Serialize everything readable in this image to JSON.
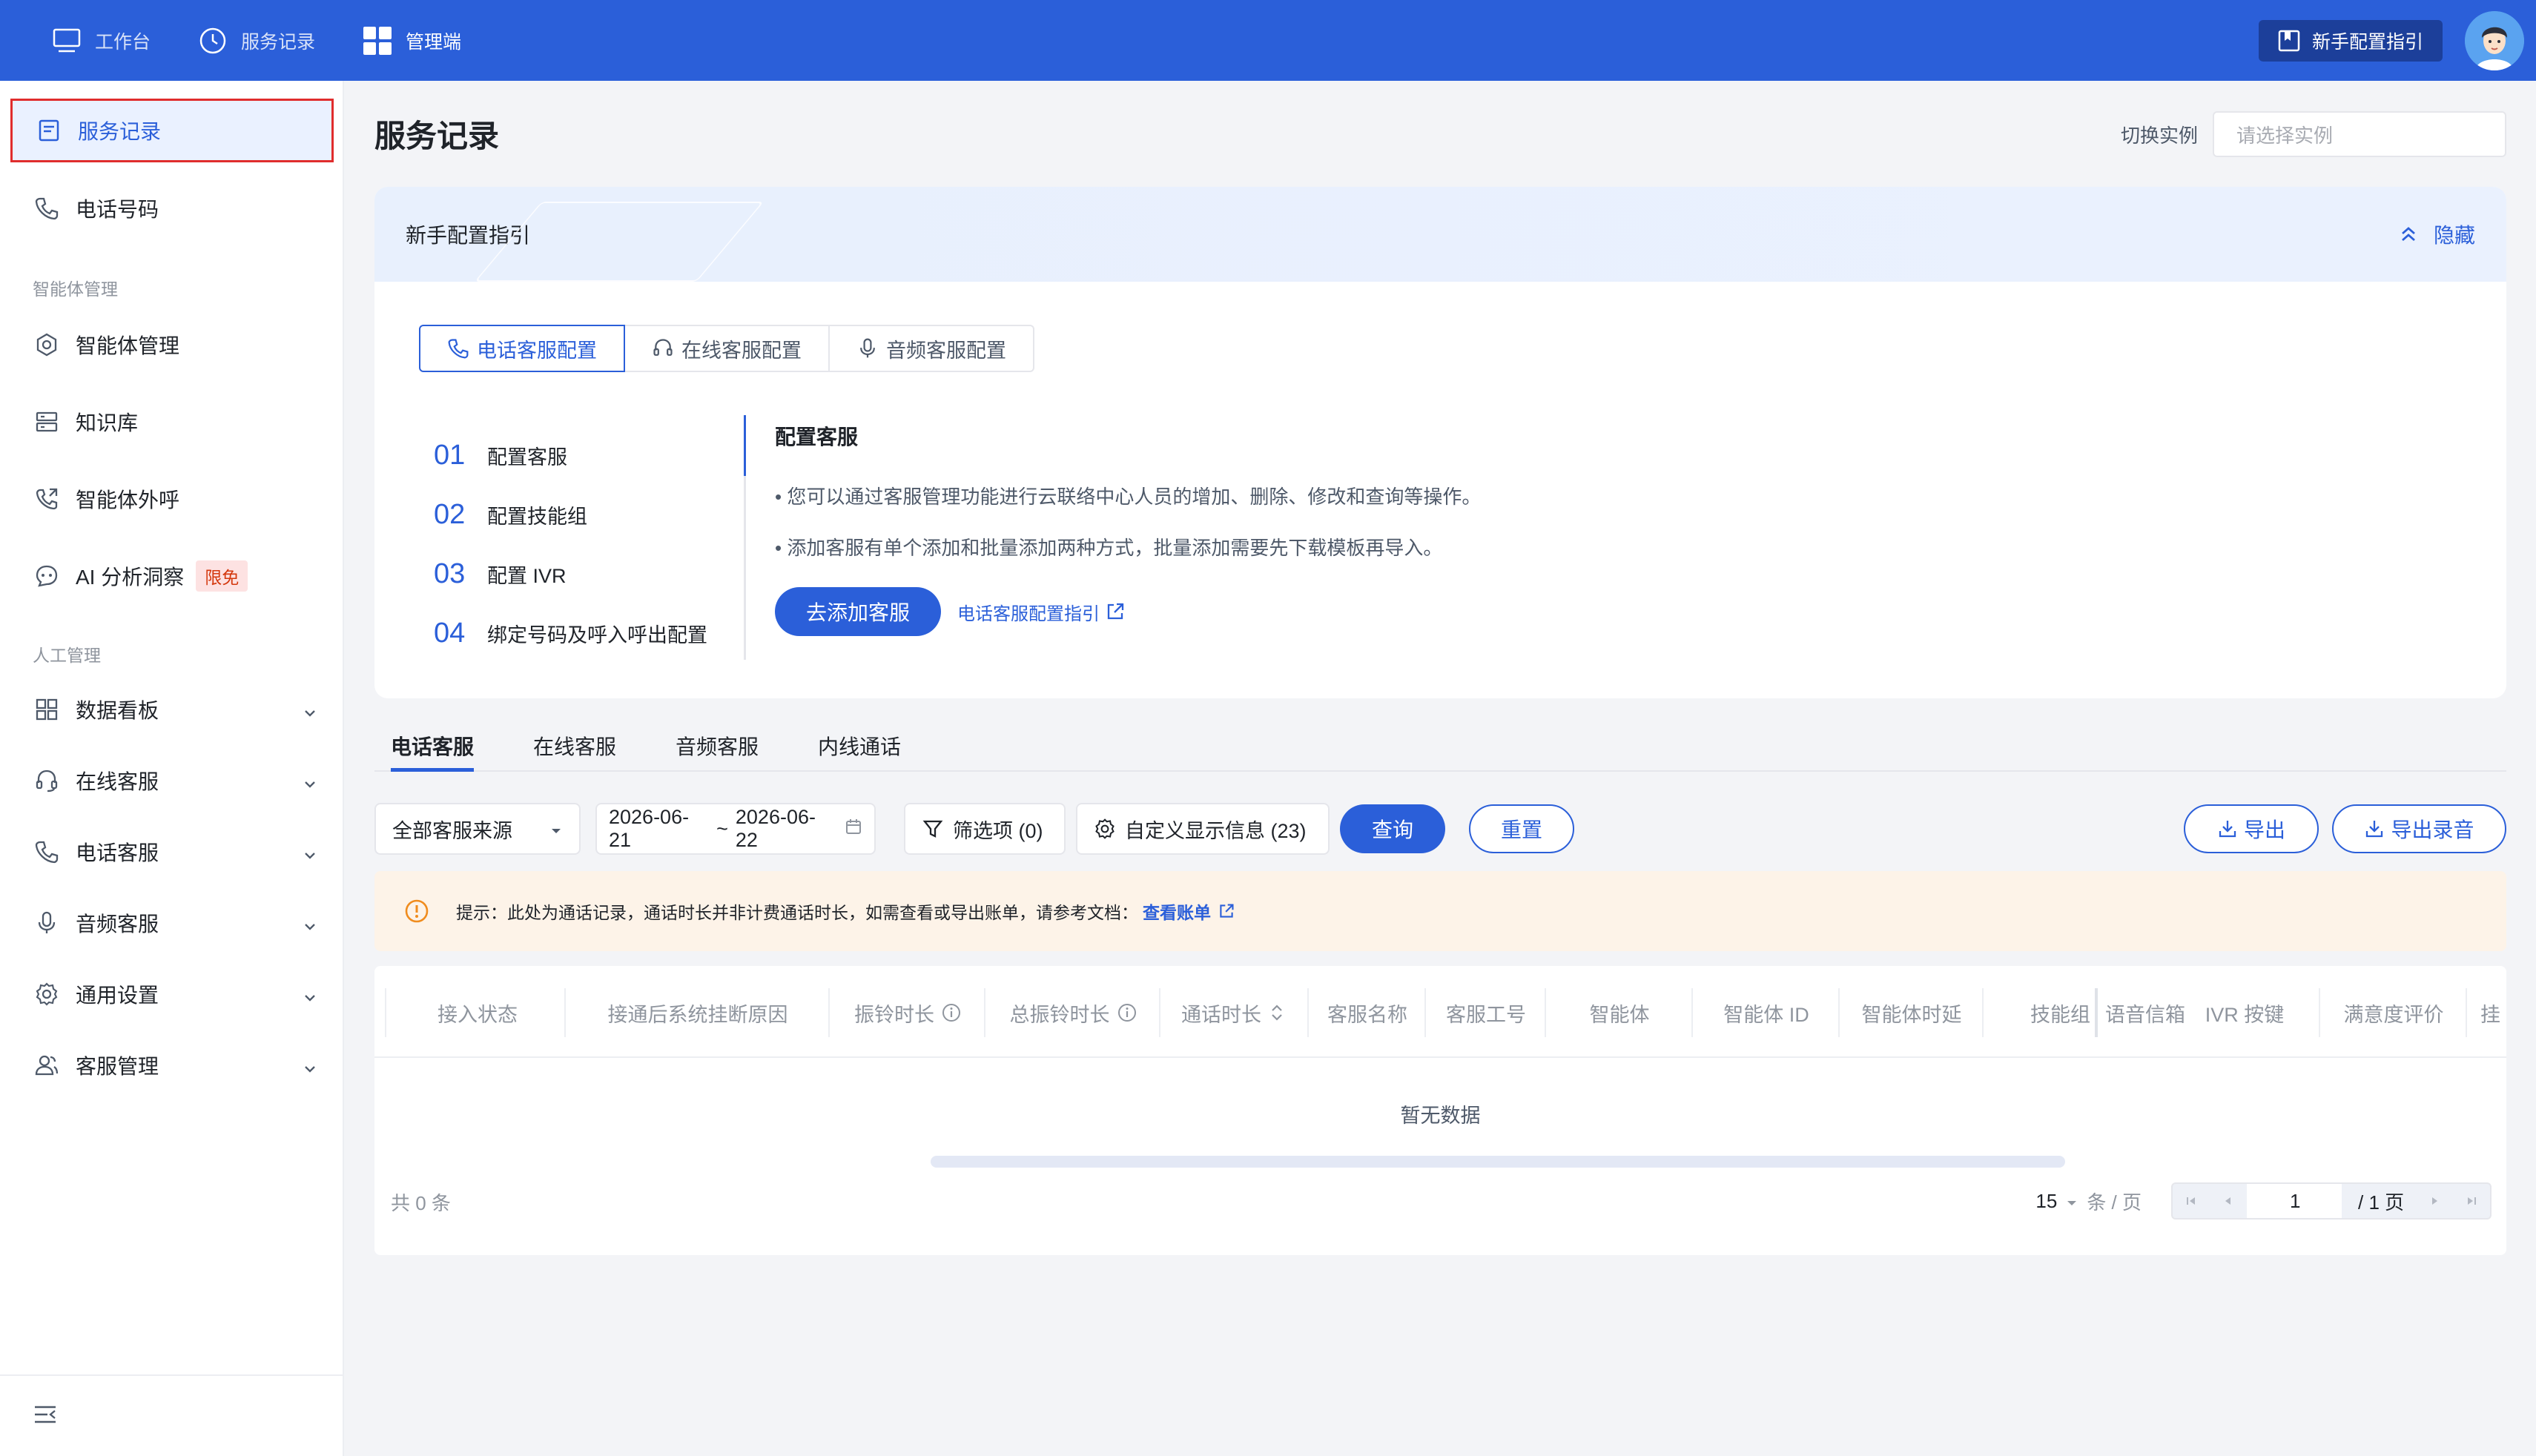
{
  "topbar": {
    "nav": [
      {
        "label": "工作台",
        "icon": "monitor-icon"
      },
      {
        "label": "服务记录",
        "icon": "clock-icon"
      },
      {
        "label": "管理端",
        "icon": "grid-icon"
      }
    ],
    "guide_label": "新手配置指引",
    "colors": {
      "brand": "#2b5fd9"
    }
  },
  "sidebar": {
    "items": [
      {
        "label": "服务记录",
        "icon": "document-icon",
        "active": true
      },
      {
        "label": "电话号码",
        "icon": "phone-icon"
      }
    ],
    "group_agent": "智能体管理",
    "agent_items": [
      {
        "label": "智能体管理",
        "icon": "hexagon-icon"
      },
      {
        "label": "知识库",
        "icon": "database-icon"
      },
      {
        "label": "智能体外呼",
        "icon": "phone-out-icon"
      },
      {
        "label": "AI 分析洞察",
        "icon": "ai-icon",
        "badge": "限免"
      }
    ],
    "group_manual": "人工管理",
    "manual_items": [
      {
        "label": "数据看板",
        "icon": "dashboard-icon"
      },
      {
        "label": "在线客服",
        "icon": "headset-icon"
      },
      {
        "label": "电话客服",
        "icon": "phone-icon"
      },
      {
        "label": "音频客服",
        "icon": "microphone-icon"
      },
      {
        "label": "通用设置",
        "icon": "gear-icon"
      },
      {
        "label": "客服管理",
        "icon": "user-group-icon"
      }
    ]
  },
  "page": {
    "title": "服务记录",
    "instance_label": "切换实例",
    "instance_placeholder": "请选择实例"
  },
  "guide": {
    "title": "新手配置指引",
    "hide_label": "隐藏",
    "segments": [
      "电话客服配置",
      "在线客服配置",
      "音频客服配置"
    ],
    "steps": [
      {
        "num": "01",
        "label": "配置客服"
      },
      {
        "num": "02",
        "label": "配置技能组"
      },
      {
        "num": "03",
        "label": "配置 IVR"
      },
      {
        "num": "04",
        "label": "绑定号码及呼入呼出配置"
      }
    ],
    "body_title": "配置客服",
    "bullets": [
      "• 您可以通过客服管理功能进行云联络中心人员的增加、删除、修改和查询等操作。",
      "• 添加客服有单个添加和批量添加两种方式，批量添加需要先下载模板再导入。"
    ],
    "action_label": "去添加客服",
    "link_label": "电话客服配置指引"
  },
  "tabs": [
    "电话客服",
    "在线客服",
    "音频客服",
    "内线通话"
  ],
  "toolbar": {
    "source": "全部客服来源",
    "date_start": "2026-06-21",
    "date_sep": "~",
    "date_end": "2026-06-22",
    "filter_label": "筛选项 (0)",
    "custom_label": "自定义显示信息 (23)",
    "query_label": "查询",
    "reset_label": "重置",
    "export_label": "导出",
    "export_audio_label": "导出录音"
  },
  "notice": {
    "text": "提示：此处为通话记录，通话时长并非计费通话时长，如需查看或导出账单，请参考文档：",
    "link": "查看账单"
  },
  "table": {
    "columns": [
      "接入状态",
      "接通后系统挂断原因",
      "振铃时长",
      "总振铃时长",
      "通话时长",
      "客服名称",
      "客服工号",
      "智能体",
      "智能体 ID",
      "智能体时延",
      "技能组",
      "语音信箱",
      "IVR 按键",
      "满意度评价",
      "挂"
    ],
    "empty_text": "暂无数据",
    "total": "共  0  条",
    "page_size": "15",
    "page_size_unit": "条 / 页",
    "current_page": "1",
    "total_pages": "/ 1 页"
  }
}
